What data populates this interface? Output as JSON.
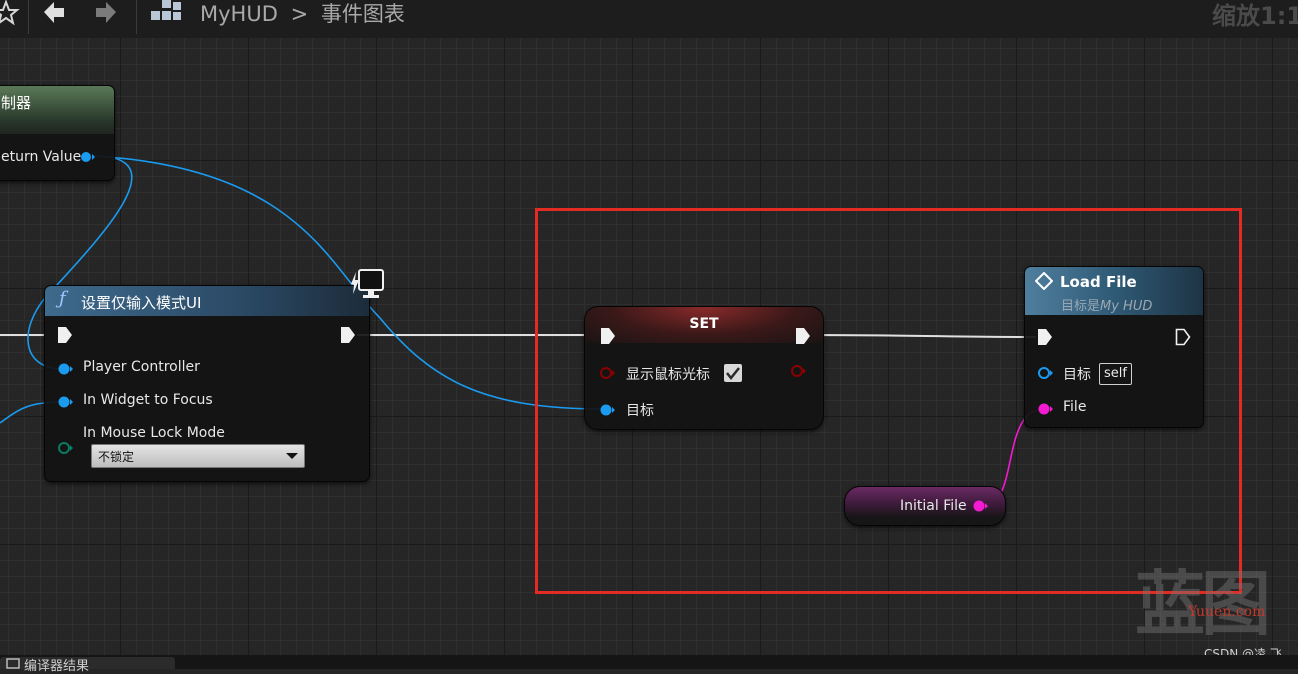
{
  "toolbar": {
    "breadcrumb_root": "MyHUD",
    "breadcrumb_sep": ">",
    "breadcrumb_current": "事件图表",
    "zoom": "缩放1:1"
  },
  "nodes": {
    "get_controller": {
      "title": "制器",
      "output_label": "eturn Value"
    },
    "set_input_mode": {
      "title": "设置仅输入模式UI",
      "pins": [
        "Player Controller",
        "In Widget to Focus",
        "In Mouse Lock Mode"
      ],
      "dropdown_value": "不锁定"
    },
    "set_node": {
      "title": "SET",
      "bool_label": "显示鼠标光标",
      "bool_checked": true,
      "target_label": "目标"
    },
    "load_file": {
      "title": "Load File",
      "subtitle_prefix": "目标是",
      "subtitle_target": "My HUD",
      "target_label": "目标",
      "target_value": "self",
      "file_label": "File"
    },
    "initial_file": {
      "label": "Initial File"
    }
  },
  "colors": {
    "object_pin": "#1a9bf0",
    "bool_pin": "#8b0000",
    "string_pin": "#f21bd2",
    "byte_pin": "#0b6b58",
    "selection": "#e12b23"
  },
  "watermark": {
    "main": "蓝图",
    "sub": "Yuuen.com"
  },
  "credit": "CSDN @凌 飞",
  "bottom_tab": "编译器结果"
}
